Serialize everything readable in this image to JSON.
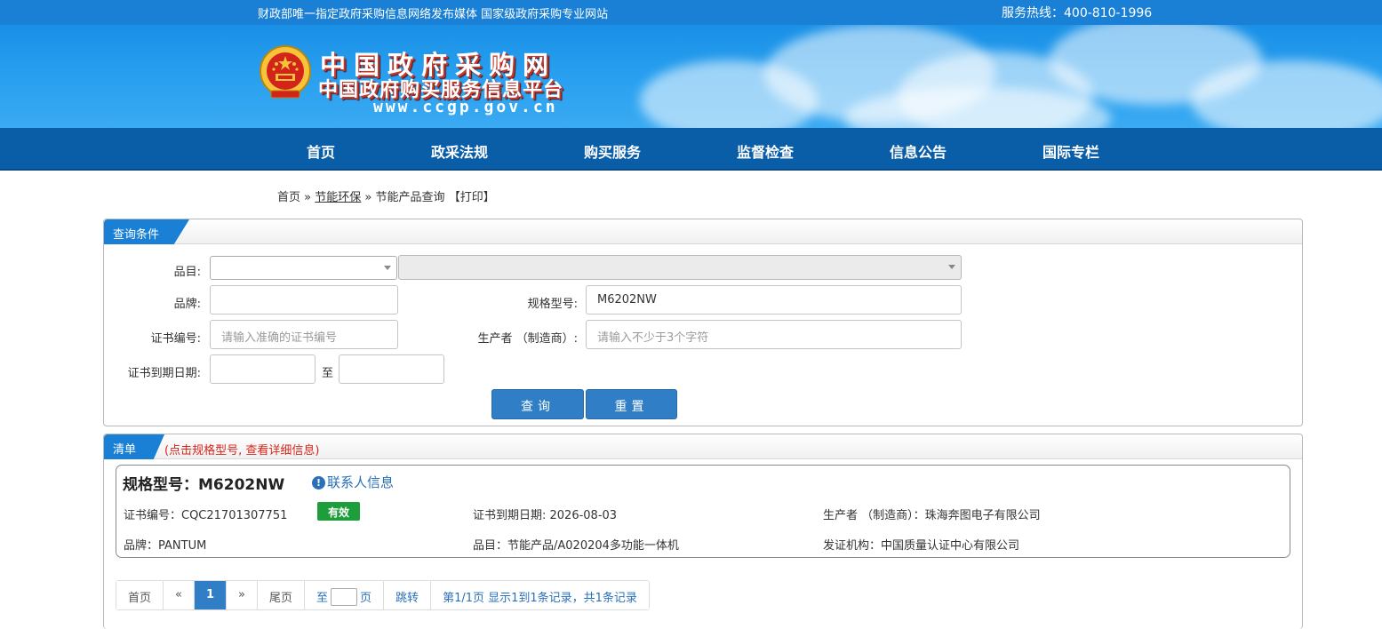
{
  "topbar": {
    "slogan": "财政部唯一指定政府采购信息网络发布媒体 国家级政府采购专业网站",
    "hotline": "服务热线：400-810-1996"
  },
  "logo": {
    "title": "中国政府采购网",
    "subtitle": "中国政府购买服务信息平台",
    "url": "www.ccgp.gov.cn"
  },
  "nav": [
    "首页",
    "政采法规",
    "购买服务",
    "监督检查",
    "信息公告",
    "国际专栏"
  ],
  "breadcrumb": {
    "home": "首页",
    "sep1": "»",
    "section": "节能环保",
    "sep2": "»",
    "page": "节能产品查询",
    "print": "【打印】"
  },
  "query": {
    "tab": "查询条件",
    "category_label": "品目:",
    "brand_label": "品牌:",
    "brand_value": "",
    "model_label": "规格型号:",
    "model_value": "M6202NW",
    "cert_label": "证书编号:",
    "cert_placeholder": "请输入准确的证书编号",
    "maker_label": "生产者 （制造商）:",
    "maker_placeholder": "请输入不少于3个字符",
    "expiry_label": "证书到期日期:",
    "to": "至",
    "search_btn": "查询",
    "reset_btn": "重置"
  },
  "list": {
    "tab": "清单",
    "note": "(点击规格型号, 查看详细信息)"
  },
  "result": {
    "model": "规格型号：M6202NW",
    "contact": "联系人信息",
    "cert_no": "证书编号：CQC21701307751",
    "status": "有效",
    "expiry": "证书到期日期: 2026-08-03",
    "maker": "生产者 （制造商）：珠海奔图电子有限公司",
    "brand": "品牌：PANTUM",
    "category": "品目：节能产品/A020204多功能一体机",
    "issuer": "发证机构：中国质量认证中心有限公司"
  },
  "pagination": {
    "first": "首页",
    "prev": "«",
    "current": "1",
    "next": "»",
    "last": "尾页",
    "goto_to": "至",
    "goto_page": "页",
    "jump": "跳转",
    "summary": "第1/1页  显示1到1条记录，共1条记录"
  },
  "colors": {
    "brand_blue": "#1a80d6",
    "nav_blue": "#0a5ea8",
    "button_blue": "#2f7ec6",
    "valid_green": "#1d9e3a",
    "note_red": "#d9261c"
  }
}
